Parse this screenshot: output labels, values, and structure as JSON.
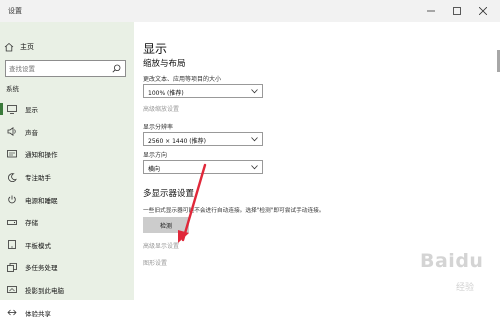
{
  "window": {
    "title": "设置"
  },
  "sidebar": {
    "home_label": "主页",
    "search_placeholder": "查找设置",
    "section_label": "系统",
    "items": [
      {
        "label": "显示",
        "icon": "monitor-icon",
        "active": true
      },
      {
        "label": "声音",
        "icon": "speaker-icon"
      },
      {
        "label": "通知和操作",
        "icon": "notification-icon"
      },
      {
        "label": "专注助手",
        "icon": "moon-icon"
      },
      {
        "label": "电源和睡眠",
        "icon": "power-icon"
      },
      {
        "label": "存储",
        "icon": "storage-icon"
      },
      {
        "label": "平板模式",
        "icon": "tablet-icon"
      },
      {
        "label": "多任务处理",
        "icon": "multitask-icon"
      },
      {
        "label": "投影到此电脑",
        "icon": "project-icon"
      },
      {
        "label": "体验共享",
        "icon": "share-icon"
      }
    ]
  },
  "main": {
    "title": "显示",
    "scale_heading": "缩放与布局",
    "scale_label": "更改文本、应用等项目的大小",
    "scale_value": "100% (推荐)",
    "advanced_scaling_link": "高级缩放设置",
    "resolution_label": "显示分辨率",
    "resolution_value": "2560 × 1440 (推荐)",
    "orientation_label": "显示方向",
    "orientation_value": "横向",
    "multi_heading": "多显示器设置",
    "multi_desc": "一些旧式显示器可能不会进行自动连接。选择\"检测\"即可尝试手动连接。",
    "detect_button": "检测",
    "advanced_display_link": "高级显示设置",
    "graphics_link": "图形设置"
  },
  "watermark": {
    "brand": "Baidu",
    "sub": "经验"
  },
  "colors": {
    "sidebar_bg": "#e9f0e5",
    "accent": "#3a7a3a",
    "arrow": "#e0283a"
  }
}
